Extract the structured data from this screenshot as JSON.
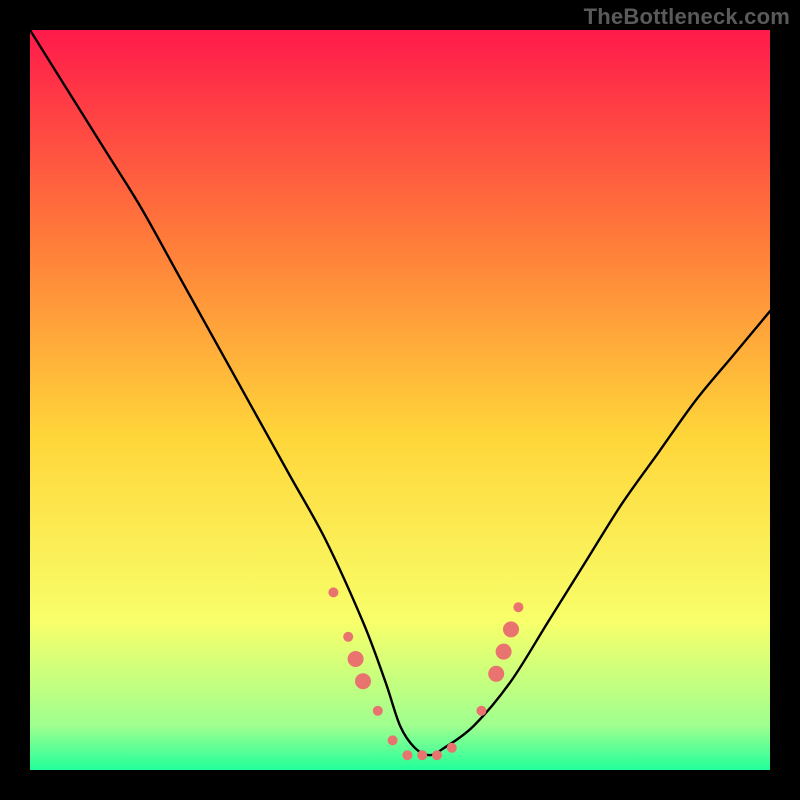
{
  "watermark": "TheBottleneck.com",
  "chart_data": {
    "type": "line",
    "title": "",
    "xlabel": "",
    "ylabel": "",
    "xlim": [
      0,
      100
    ],
    "ylim": [
      0,
      100
    ],
    "grid": false,
    "legend": false,
    "background_gradient": {
      "top": "#ff1a4b",
      "upper_mid": "#ff7a3a",
      "mid": "#ffd63a",
      "lower_mid": "#f8ff6a",
      "bottom_band": "#9fff8f",
      "bottom_edge": "#21ff9a"
    },
    "series": [
      {
        "name": "bottleneck-curve",
        "x": [
          0,
          5,
          10,
          15,
          20,
          25,
          30,
          35,
          40,
          45,
          48,
          50,
          52,
          54,
          56,
          60,
          65,
          70,
          75,
          80,
          85,
          90,
          95,
          100
        ],
        "y": [
          100,
          92,
          84,
          76,
          67,
          58,
          49,
          40,
          31,
          20,
          12,
          6,
          3,
          2,
          3,
          6,
          12,
          20,
          28,
          36,
          43,
          50,
          56,
          62
        ]
      }
    ],
    "markers": [
      {
        "x": 41,
        "y": 24
      },
      {
        "x": 43,
        "y": 18
      },
      {
        "x": 44,
        "y": 15
      },
      {
        "x": 45,
        "y": 12
      },
      {
        "x": 47,
        "y": 8
      },
      {
        "x": 49,
        "y": 4
      },
      {
        "x": 51,
        "y": 2
      },
      {
        "x": 53,
        "y": 2
      },
      {
        "x": 55,
        "y": 2
      },
      {
        "x": 57,
        "y": 3
      },
      {
        "x": 61,
        "y": 8
      },
      {
        "x": 63,
        "y": 13
      },
      {
        "x": 64,
        "y": 16
      },
      {
        "x": 65,
        "y": 19
      },
      {
        "x": 66,
        "y": 22
      }
    ],
    "marker_style": {
      "fill": "#e9736f",
      "radius_small": 5,
      "radius_large": 8
    }
  }
}
